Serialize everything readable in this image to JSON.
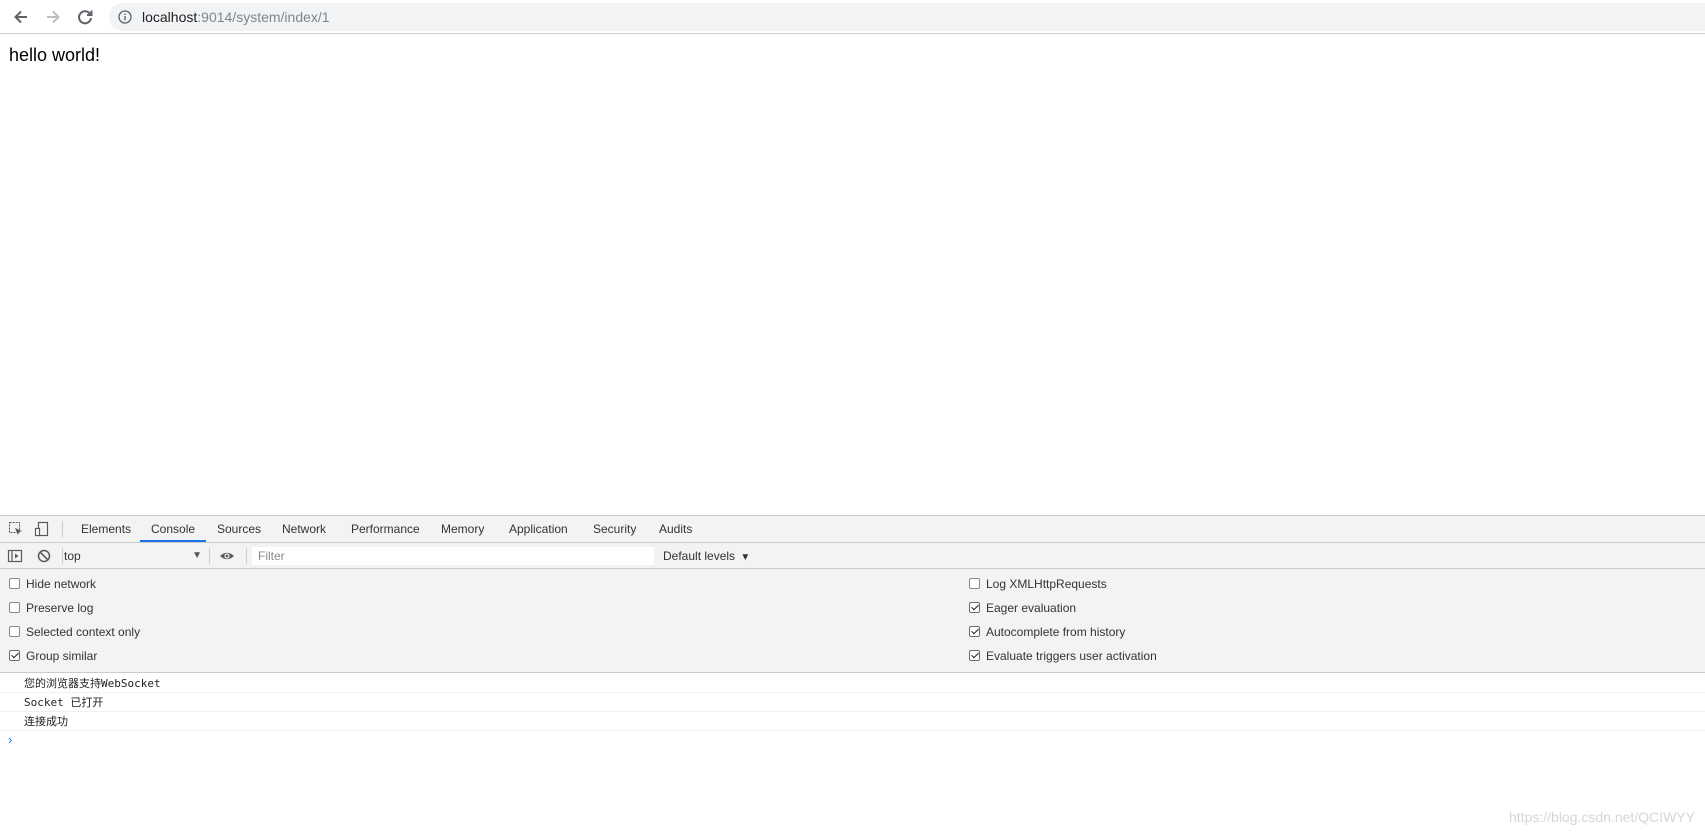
{
  "browser": {
    "url_host": "localhost",
    "url_path": ":9014/system/index/1",
    "icons": {
      "back": "arrow-left-icon",
      "forward": "arrow-right-icon",
      "reload": "reload-icon",
      "info": "info-circle-icon"
    }
  },
  "page": {
    "body_text": "hello world!"
  },
  "devtools": {
    "tabs": [
      {
        "label": "Elements"
      },
      {
        "label": "Console",
        "active": true
      },
      {
        "label": "Sources"
      },
      {
        "label": "Network"
      },
      {
        "label": "Performance"
      },
      {
        "label": "Memory"
      },
      {
        "label": "Application"
      },
      {
        "label": "Security"
      },
      {
        "label": "Audits"
      }
    ],
    "console_toolbar": {
      "context": "top",
      "filter_placeholder": "Filter",
      "levels": "Default levels"
    },
    "settings": {
      "left": [
        {
          "label": "Hide network",
          "checked": false
        },
        {
          "label": "Preserve log",
          "checked": false
        },
        {
          "label": "Selected context only",
          "checked": false
        },
        {
          "label": "Group similar",
          "checked": true
        }
      ],
      "right": [
        {
          "label": "Log XMLHttpRequests",
          "checked": false
        },
        {
          "label": "Eager evaluation",
          "checked": true
        },
        {
          "label": "Autocomplete from history",
          "checked": true
        },
        {
          "label": "Evaluate triggers user activation",
          "checked": true
        }
      ]
    },
    "messages": [
      "您的浏览器支持WebSocket",
      "Socket 已打开",
      "连接成功"
    ],
    "prompt": "›",
    "accent_color": "#1a73e8"
  },
  "watermark": "https://blog.csdn.net/QCIWYY"
}
